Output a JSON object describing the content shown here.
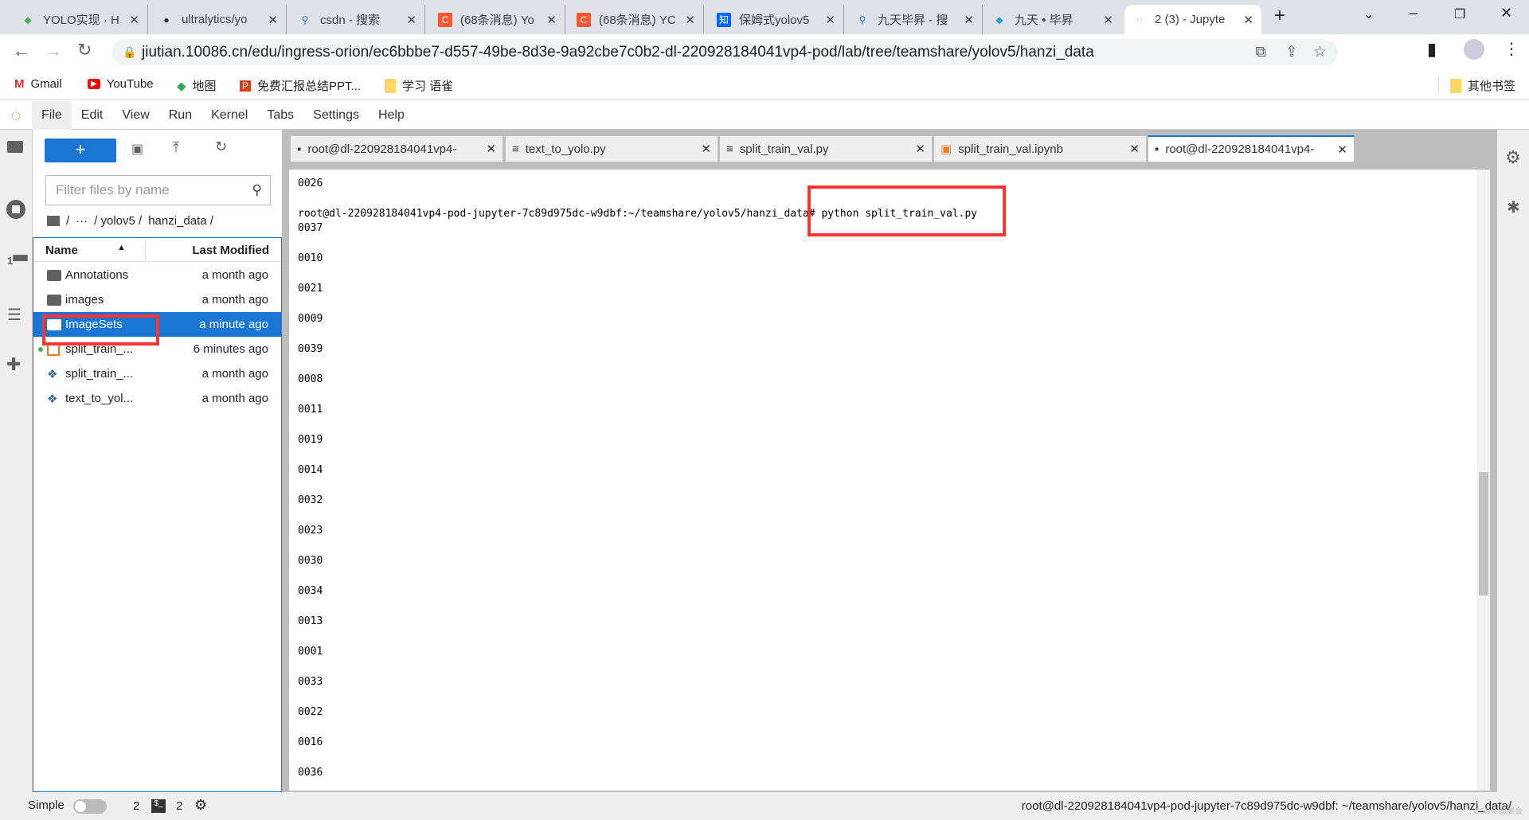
{
  "browser": {
    "tabs": [
      {
        "title": "YOLO实现 · H",
        "icon": "feather-icon",
        "color": "#4caf50"
      },
      {
        "title": "ultralytics/yo",
        "icon": "github-icon",
        "color": "#24292e"
      },
      {
        "title": "csdn - 搜索",
        "icon": "search-icon",
        "color": "#1a73e8"
      },
      {
        "title": "(68条消息) Yo",
        "icon": "csdn-icon",
        "color": "#fc5531"
      },
      {
        "title": "(68条消息) YC",
        "icon": "csdn-icon",
        "color": "#fc5531"
      },
      {
        "title": "保姆式yolov5",
        "icon": "zhihu-icon",
        "color": "#0066ff"
      },
      {
        "title": "九天毕昇 - 搜",
        "icon": "search-icon",
        "color": "#1a73e8"
      },
      {
        "title": "九天 • 毕昇",
        "icon": "jiutian-icon",
        "color": "#2a9fd6"
      },
      {
        "title": "2 (3) - Jupyte",
        "icon": "jupyter-icon",
        "color": "#f37726"
      }
    ],
    "url": "jiutian.10086.cn/edu/ingress-orion/ec6bbbe7-d557-49be-8d3e-9a92cbe7c0b2-dl-220928184041vp4-pod/lab/tree/teamshare/yolov5/hanzi_data",
    "bookmarks": [
      "Gmail",
      "YouTube",
      "地图",
      "免费汇报总结PPT...",
      "学习 语雀"
    ],
    "other_bookmarks": "其他书签"
  },
  "menu": [
    "File",
    "Edit",
    "View",
    "Run",
    "Kernel",
    "Tabs",
    "Settings",
    "Help"
  ],
  "filebrowser": {
    "filter_placeholder": "Filter files by name",
    "breadcrumb": [
      "/",
      "···",
      "/ yolov5 /",
      "hanzi_data /"
    ],
    "col_name": "Name",
    "col_modified": "Last Modified",
    "files": [
      {
        "name": "Annotations",
        "modified": "a month ago",
        "type": "folder"
      },
      {
        "name": "images",
        "modified": "a month ago",
        "type": "folder"
      },
      {
        "name": "ImageSets",
        "modified": "a minute ago",
        "type": "folder",
        "selected": true
      },
      {
        "name": "split_train_...",
        "modified": "6 minutes ago",
        "type": "notebook",
        "running": true
      },
      {
        "name": "split_train_...",
        "modified": "a month ago",
        "type": "python"
      },
      {
        "name": "text_to_yol...",
        "modified": "a month ago",
        "type": "python"
      }
    ]
  },
  "doc_tabs": [
    {
      "label": "root@dl-220928184041vp4-",
      "icon": "terminal-icon"
    },
    {
      "label": "text_to_yolo.py",
      "icon": "text-file-icon"
    },
    {
      "label": "split_train_val.py",
      "icon": "text-file-icon"
    },
    {
      "label": "split_train_val.ipynb",
      "icon": "notebook-icon"
    },
    {
      "label": "root@dl-220928184041vp4-",
      "icon": "terminal-icon",
      "active": true
    }
  ],
  "terminal": {
    "first": "0026",
    "prompt": "root@dl-220928184041vp4-pod-jupyter-7c89d975dc-w9dbf:~/teamshare/yolov5/hanzi_data# python split_train_val.py",
    "output": [
      "0037",
      "0010",
      "0021",
      "0009",
      "0039",
      "0008",
      "0011",
      "0019",
      "0014",
      "0032",
      "0023",
      "0030",
      "0034",
      "0013",
      "0001",
      "0033",
      "0022",
      "0016",
      "0036"
    ]
  },
  "status": {
    "mode": "Simple",
    "kernels": "2",
    "terminals": "2",
    "path": "root@dl-220928184041vp4-pod-jupyter-7c89d975dc-w9dbf: ~/teamshare/yolov5/hanzi_data/",
    "watermark": "CSDN @晨会"
  },
  "colors": {
    "accent": "#1976d2",
    "highlight": "#ff3333"
  }
}
